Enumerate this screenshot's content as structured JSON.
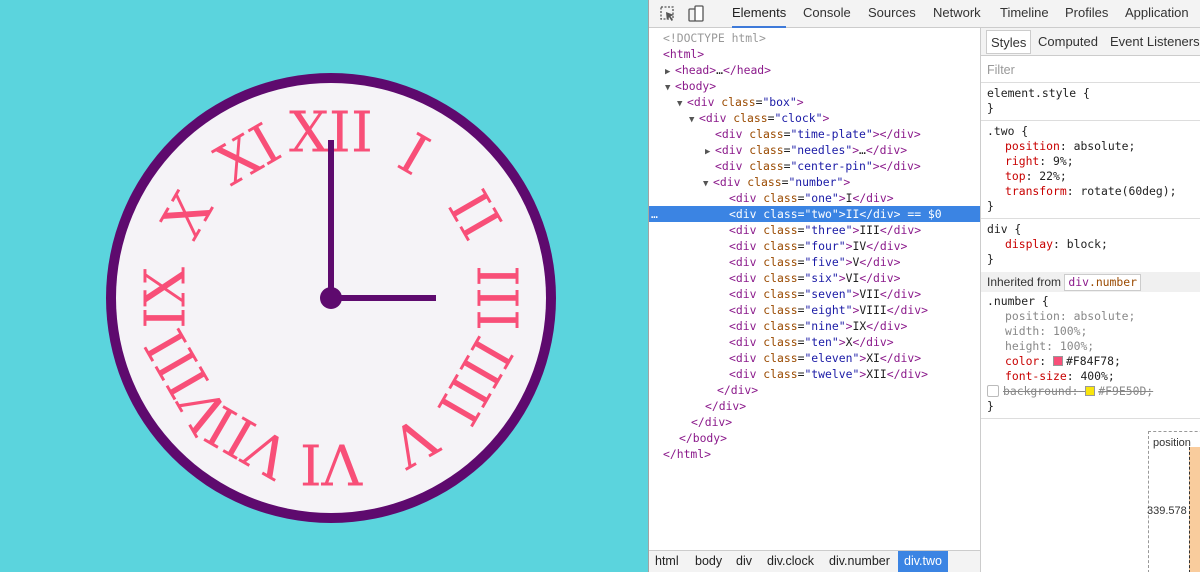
{
  "clock": {
    "numerals": [
      "XII",
      "I",
      "II",
      "III",
      "IIII",
      "V",
      "VI",
      "VII",
      "VIII",
      "IX",
      "X",
      "XI"
    ],
    "time": "3:00",
    "colors": {
      "background": "#5BD4DD",
      "rim": "#5E0A6E",
      "face": "#F5F3F7",
      "numerals": "#F84F78",
      "hands": "#5E0A6E"
    }
  },
  "toolbar": {
    "icons": [
      "inspect-cursor-icon",
      "device-mode-icon"
    ],
    "tabs": [
      "Elements",
      "Console",
      "Sources",
      "Network",
      "Timeline",
      "Profiles",
      "Application"
    ],
    "active_tab": "Elements"
  },
  "dom": {
    "doctype": "<!DOCTYPE html>",
    "html_open": "html",
    "head": "head",
    "head_ellipsis": "…",
    "body": "body",
    "box_tag": "div",
    "box_attr": "class",
    "box_val": "\"box\"",
    "clock_tag": "div",
    "clock_attr": "class",
    "clock_val": "\"clock\"",
    "children": [
      {
        "tag": "div",
        "attr": "class",
        "val": "\"time-plate\"",
        "text": "",
        "tri": ""
      },
      {
        "tag": "div",
        "attr": "class",
        "val": "\"needles\"",
        "text": "…",
        "tri": "▶"
      },
      {
        "tag": "div",
        "attr": "class",
        "val": "\"center-pin\"",
        "text": "",
        "tri": ""
      }
    ],
    "number_tag": "div",
    "number_attr": "class",
    "number_val": "\"number\"",
    "numbers": [
      {
        "val": "\"one\"",
        "text": "I"
      },
      {
        "val": "\"two\"",
        "text": "II"
      },
      {
        "val": "\"three\"",
        "text": "III"
      },
      {
        "val": "\"four\"",
        "text": "IV"
      },
      {
        "val": "\"five\"",
        "text": "V"
      },
      {
        "val": "\"six\"",
        "text": "VI"
      },
      {
        "val": "\"seven\"",
        "text": "VII"
      },
      {
        "val": "\"eight\"",
        "text": "VIII"
      },
      {
        "val": "\"nine\"",
        "text": "IX"
      },
      {
        "val": "\"ten\"",
        "text": "X"
      },
      {
        "val": "\"eleven\"",
        "text": "XI"
      },
      {
        "val": "\"twelve\"",
        "text": "XII"
      }
    ],
    "selected_suffix": "== $0",
    "selected_dots": "…",
    "close_div": "/div",
    "close_body": "/body",
    "close_html": "/html"
  },
  "breadcrumbs": [
    "html",
    "body",
    "div",
    "div.clock",
    "div.number",
    "div.two"
  ],
  "styles": {
    "tabs": [
      "Styles",
      "Computed",
      "Event Listeners"
    ],
    "filter_placeholder": "Filter",
    "element_style": "element.style {",
    "close_brace": "}",
    "rule_two_selector": ".two {",
    "rule_two": [
      {
        "prop": "position",
        "value": "absolute;"
      },
      {
        "prop": "right",
        "value": "9%;"
      },
      {
        "prop": "top",
        "value": "22%;"
      },
      {
        "prop": "transform",
        "value": "rotate(60deg);"
      }
    ],
    "rule_div_selector": "div {",
    "rule_div": [
      {
        "prop": "display",
        "value": "block;"
      }
    ],
    "inherited_label": "Inherited from",
    "inherited_tag": "div",
    "inherited_class": ".number",
    "rule_number_selector": ".number {",
    "rule_number": [
      {
        "prop": "position",
        "value": "absolute;"
      },
      {
        "prop": "width",
        "value": "100%;"
      },
      {
        "prop": "height",
        "value": "100%;"
      },
      {
        "prop": "color",
        "value": "#F84F78;"
      },
      {
        "prop": "font-size",
        "value": "400%;"
      }
    ],
    "background_prop": "background:",
    "background_value": "#F9E50D;",
    "color_swatch": "#F84F78",
    "bg_swatch": "#F9E50D"
  },
  "box_model": {
    "label": "position",
    "value": "339.578"
  }
}
